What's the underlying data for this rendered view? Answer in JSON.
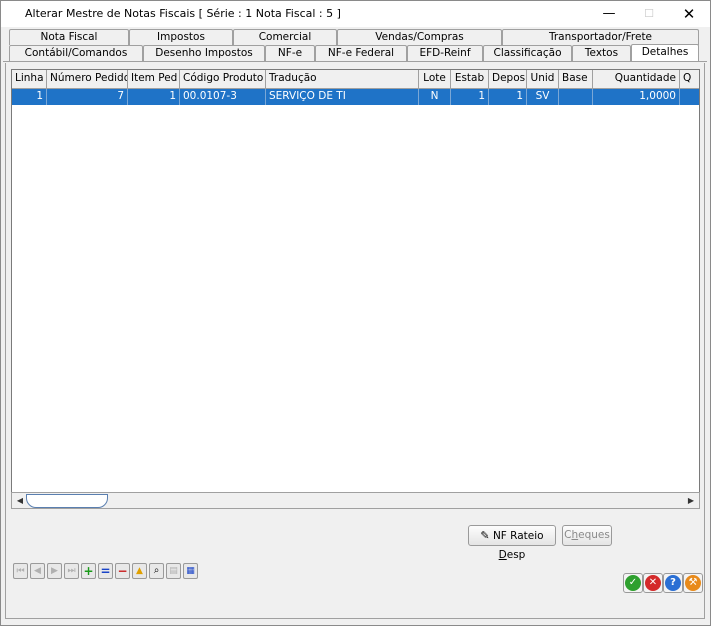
{
  "window": {
    "title": "Alterar Mestre de Notas Fiscais [ Série : 1  Nota Fiscal : 5 ]",
    "minimize": "—",
    "maximize": "☐",
    "close": "✕"
  },
  "tabs_row1": [
    "Nota Fiscal",
    "Impostos",
    "Comercial",
    "Vendas/Compras",
    "Transportador/Frete"
  ],
  "tabs_row2": [
    "Contábil/Comandos",
    "Desenho Impostos",
    "NF-e",
    "NF-e Federal",
    "EFD-Reinf",
    "Classificação",
    "Textos",
    "Detalhes"
  ],
  "active_tab": "Detalhes",
  "grid": {
    "columns": [
      "Linha",
      "Número Pedido",
      "Item Ped",
      "Código Produto",
      "Tradução",
      "Lote",
      "Estab",
      "Depos",
      "Unid",
      "Base",
      "Quantidade",
      "Q"
    ],
    "rows": [
      {
        "linha": "1",
        "numero_pedido": "7",
        "item_ped": "1",
        "codigo_produto": "00.0107-3",
        "traducao": "SERVIÇO DE TI",
        "lote": "N",
        "estab": "1",
        "depos": "1",
        "unid": "SV",
        "base": "",
        "quantidade": "1,0000"
      }
    ]
  },
  "buttons": {
    "nf_rateio_pre": "NF Rateio ",
    "nf_rateio_accel": "D",
    "nf_rateio_post": "esp",
    "cheques_pre": "C",
    "cheques_accel": "h",
    "cheques_post": "eques"
  },
  "colors": {
    "selection": "#1f73c7",
    "ok": "#2ea02e",
    "cancel": "#d42a2a",
    "help": "#2a6fd4",
    "tools": "#e88a1a"
  }
}
